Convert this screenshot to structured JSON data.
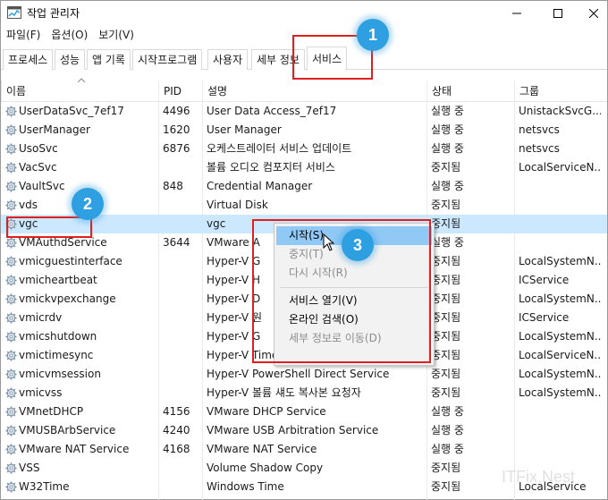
{
  "window": {
    "title": "작업 관리자",
    "controls": {
      "minimize": "minimize-icon",
      "maximize": "maximize-icon",
      "close": "close-icon"
    }
  },
  "menu": [
    "파일(F)",
    "옵션(O)",
    "보기(V)"
  ],
  "tabs": [
    "프로세스",
    "성능",
    "앱 기록",
    "시작프로그램",
    "사용자",
    "세부 정보",
    "서비스"
  ],
  "active_tab": "서비스",
  "columns": {
    "name": "이름",
    "pid": "PID",
    "desc": "설명",
    "state": "상태",
    "group": "그룹"
  },
  "services": [
    {
      "name": "UserDataSvc_7ef17",
      "pid": "4496",
      "desc": "User Data Access_7ef17",
      "state": "실행 중",
      "group": "UnistackSvcG..."
    },
    {
      "name": "UserManager",
      "pid": "1620",
      "desc": "User Manager",
      "state": "실행 중",
      "group": "netsvcs"
    },
    {
      "name": "UsoSvc",
      "pid": "6876",
      "desc": "오케스트레이터 서비스 업데이트",
      "state": "실행 중",
      "group": "netsvcs"
    },
    {
      "name": "VacSvc",
      "pid": "",
      "desc": "볼륨 오디오 컴포지터 서비스",
      "state": "중지됨",
      "group": "LocalServiceN..."
    },
    {
      "name": "VaultSvc",
      "pid": "848",
      "desc": "Credential Manager",
      "state": "실행 중",
      "group": ""
    },
    {
      "name": "vds",
      "pid": "",
      "desc": "Virtual Disk",
      "state": "중지됨",
      "group": ""
    },
    {
      "name": "vgc",
      "pid": "",
      "desc": "vgc",
      "state": "중지됨",
      "group": ""
    },
    {
      "name": "VMAuthdService",
      "pid": "3644",
      "desc": "VMware A",
      "state": "실행 중",
      "group": ""
    },
    {
      "name": "vmicguestinterface",
      "pid": "",
      "desc": "Hyper-V G",
      "state": "중지됨",
      "group": "LocalSystemN..."
    },
    {
      "name": "vmicheartbeat",
      "pid": "",
      "desc": "Hyper-V H",
      "state": "중지됨",
      "group": "ICService"
    },
    {
      "name": "vmickvpexchange",
      "pid": "",
      "desc": "Hyper-V D",
      "state": "중지됨",
      "group": "LocalSystemN..."
    },
    {
      "name": "vmicrdv",
      "pid": "",
      "desc": "Hyper-V 원",
      "state": "중지됨",
      "group": "ICService"
    },
    {
      "name": "vmicshutdown",
      "pid": "",
      "desc": "Hyper-V G",
      "state": "중지됨",
      "group": "LocalSystemN..."
    },
    {
      "name": "vmictimesync",
      "pid": "",
      "desc": "Hyper-V Time Synchronization Service",
      "state": "중지됨",
      "group": "LocalServiceN..."
    },
    {
      "name": "vmicvmsession",
      "pid": "",
      "desc": "Hyper-V PowerShell Direct Service",
      "state": "중지됨",
      "group": "LocalSystemN..."
    },
    {
      "name": "vmicvss",
      "pid": "",
      "desc": "Hyper-V 볼륨 섀도 복사본 요청자",
      "state": "중지됨",
      "group": "LocalSystemN..."
    },
    {
      "name": "VMnetDHCP",
      "pid": "4156",
      "desc": "VMware DHCP Service",
      "state": "실행 중",
      "group": ""
    },
    {
      "name": "VMUSBArbService",
      "pid": "4240",
      "desc": "VMware USB Arbitration Service",
      "state": "실행 중",
      "group": ""
    },
    {
      "name": "VMware NAT Service",
      "pid": "4168",
      "desc": "VMware NAT Service",
      "state": "실행 중",
      "group": ""
    },
    {
      "name": "VSS",
      "pid": "",
      "desc": "Volume Shadow Copy",
      "state": "중지됨",
      "group": ""
    },
    {
      "name": "W32Time",
      "pid": "",
      "desc": "Windows Time",
      "state": "중지됨",
      "group": "LocalService"
    }
  ],
  "selected_service": "vgc",
  "context_menu": {
    "items": [
      {
        "label": "시작(S)",
        "enabled": true,
        "highlighted": true
      },
      {
        "label": "중지(T)",
        "enabled": false
      },
      {
        "label": "다시 시작(R)",
        "enabled": false
      },
      {
        "label": "서비스 열기(V)",
        "enabled": true
      },
      {
        "label": "온라인 검색(O)",
        "enabled": true
      },
      {
        "label": "세부 정보로 이동(D)",
        "enabled": false
      }
    ]
  },
  "annotations": {
    "badges": [
      "1",
      "2",
      "3"
    ],
    "accent": "#2e9fe0",
    "box_color": "#e02020"
  },
  "colors": {
    "selected_row": "#cce8ff",
    "menu_highlight": "#90c8f6"
  }
}
